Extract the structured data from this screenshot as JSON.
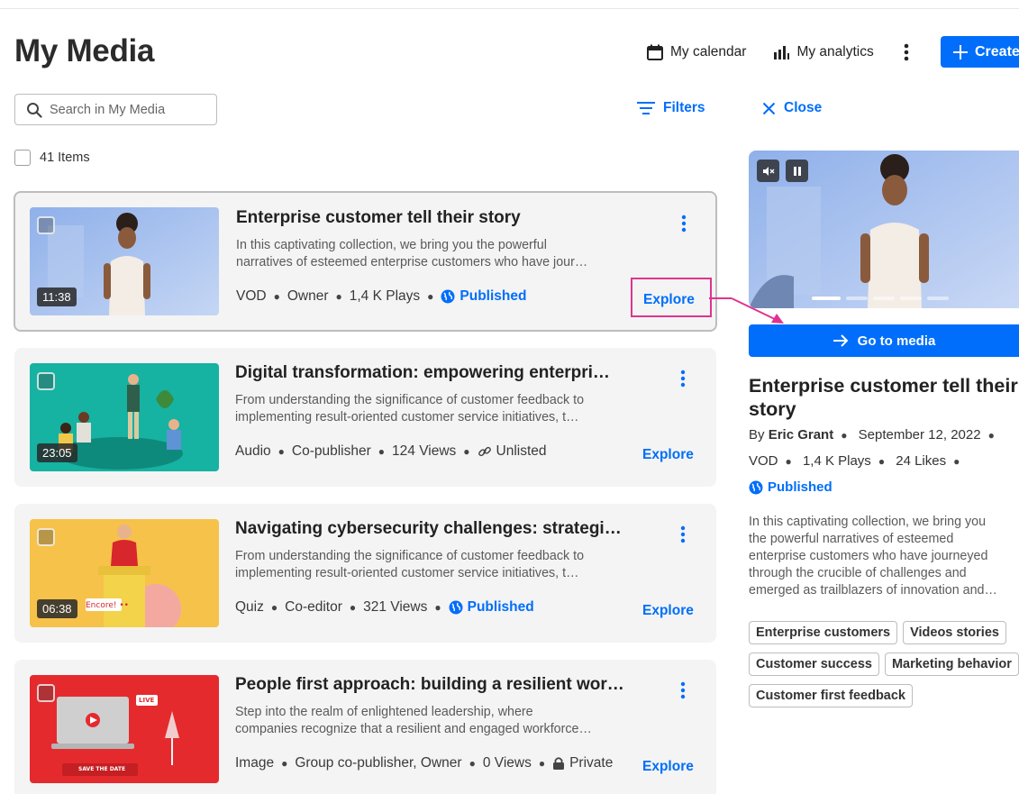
{
  "page": {
    "title": "My Media"
  },
  "header": {
    "calendar_label": "My calendar",
    "analytics_label": "My analytics",
    "create_label": "Create"
  },
  "search": {
    "placeholder": "Search in My Media"
  },
  "toolbar": {
    "filters_label": "Filters",
    "close_label": "Close"
  },
  "list": {
    "count_label": "41 Items"
  },
  "items": [
    {
      "title": "Enterprise customer tell their story",
      "desc": [
        "In this captivating collection, we bring you the powerful",
        "narratives of esteemed enterprise customers who have jour…"
      ],
      "duration": "11:38",
      "type": "VOD",
      "role": "Owner",
      "stat": "1,4 K Plays",
      "status": "Published",
      "status_icon": "globe-icon",
      "explore_label": "Explore",
      "thumb_color": "#a9c4ee"
    },
    {
      "title": "Digital transformation: empowering enterpri…",
      "desc": [
        "From understanding the significance of customer feedback to",
        "implementing result-oriented customer service initiatives, t…"
      ],
      "duration": "23:05",
      "type": "Audio",
      "role": "Co-publisher",
      "stat": "124 Views",
      "status": "Unlisted",
      "status_icon": "link-icon",
      "explore_label": "Explore",
      "thumb_color": "#17b3a3"
    },
    {
      "title": "Navigating cybersecurity challenges: strategi…",
      "desc": [
        "From understanding the significance of customer feedback to",
        "implementing result-oriented customer service initiatives, t…"
      ],
      "duration": "06:38",
      "badge": "Encore! ••",
      "type": "Quiz",
      "role": "Co-editor",
      "stat": "321 Views",
      "status": "Published",
      "status_icon": "globe-icon",
      "explore_label": "Explore",
      "thumb_color": "#f6c24a"
    },
    {
      "title": "People first approach: building a resilient wor…",
      "desc": [
        "Step into the realm of enlightened leadership, where",
        "companies recognize that a resilient and engaged workforce…"
      ],
      "type": "Image",
      "role": "Group co-publisher, Owner",
      "stat": "0 Views",
      "status": "Private",
      "status_icon": "lock-icon",
      "explore_label": "Explore",
      "thumb_color": "#e8262b",
      "thumb_badges": {
        "live": "LIVE",
        "save": "SAVE THE DATE"
      }
    }
  ],
  "panel": {
    "go_label": "Go to media",
    "title": "Enterprise customer tell their story",
    "by_prefix": "By",
    "author": "Eric Grant",
    "date": "September 12, 2022",
    "type": "VOD",
    "plays": "1,4 K Plays",
    "likes": "24 Likes",
    "status": "Published",
    "desc": [
      "In this captivating collection, we bring you",
      "the powerful narratives of esteemed",
      "enterprise customers who have journeyed",
      "through the crucible of challenges and",
      "emerged as trailblazers of innovation and…"
    ],
    "tags": [
      [
        "Enterprise customers",
        "Videos stories"
      ],
      [
        "Customer success",
        "Marketing behavior"
      ],
      [
        "Customer first feedback"
      ]
    ]
  },
  "colors": {
    "accent": "#006efa",
    "highlight": "#e0338f",
    "card_bg": "#f4f4f4"
  }
}
